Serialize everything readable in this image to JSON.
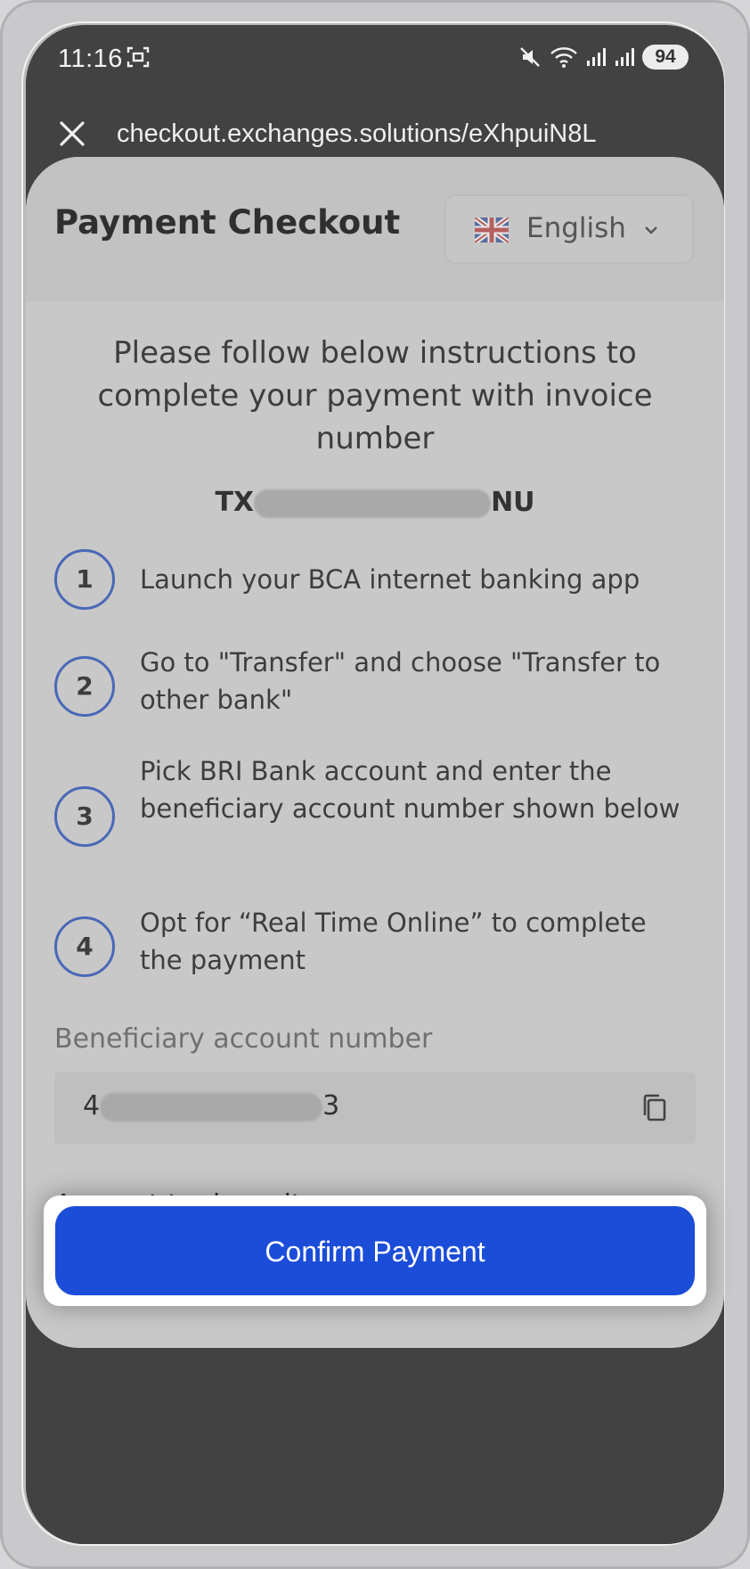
{
  "status_bar": {
    "time": "11:16",
    "battery": "94",
    "icons": [
      "screenshot-icon",
      "mute-icon",
      "wifi-icon",
      "signal-icon",
      "signal-icon"
    ]
  },
  "browser": {
    "url": "checkout.exchanges.solutions/eXhpuiN8L",
    "close_icon": "close-icon"
  },
  "header": {
    "title": "Payment Checkout",
    "language": "English",
    "language_flag": "uk-flag-icon"
  },
  "instructions": {
    "text": "Please follow below instructions to complete your payment with invoice number",
    "invoice_prefix": "TX",
    "invoice_suffix": "NU"
  },
  "steps": [
    {
      "number": "1",
      "text": "Launch your BCA internet banking app"
    },
    {
      "number": "2",
      "text": "Go to \"Transfer\" and choose \"Transfer to other bank\""
    },
    {
      "number": "3",
      "text": "Pick BRI Bank account and enter the beneficiary account number shown below"
    },
    {
      "number": "4",
      "text": "Opt for “Real Time Online” to complete the payment"
    }
  ],
  "beneficiary": {
    "label": "Beneficiary account number",
    "value_prefix": "4",
    "value_suffix": "3",
    "copy_icon": "copy-icon"
  },
  "amount": {
    "label": "Amount to deposit"
  },
  "actions": {
    "confirm_label": "Confirm Payment"
  },
  "colors": {
    "primary": "#1b4dd8",
    "step_ring": "#4a68b7",
    "dark": "#424242"
  }
}
